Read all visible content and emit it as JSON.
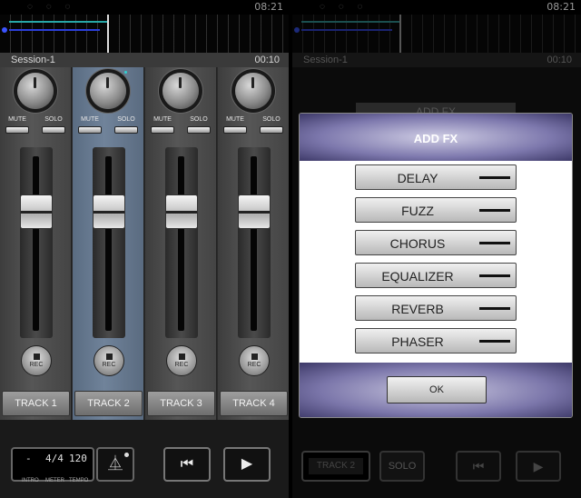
{
  "status": {
    "time": "08:21"
  },
  "session": {
    "name": "Session-1",
    "time": "00:10"
  },
  "mixer": {
    "mute_label": "MUTE",
    "solo_label": "SOLO",
    "rec_label": "REC",
    "tracks": [
      {
        "label": "TRACK 1",
        "selected": false
      },
      {
        "label": "TRACK 2",
        "selected": true
      },
      {
        "label": "TRACK 3",
        "selected": false
      },
      {
        "label": "TRACK 4",
        "selected": false
      }
    ]
  },
  "transport": {
    "intro_value": "-",
    "meter_value": "4/4",
    "tempo_value": "120",
    "intro_label": "INTRO",
    "meter_label": "METER",
    "tempo_label": "TEMPO"
  },
  "background_panel": {
    "add_fx_button": "ADD FX",
    "track_label": "TRACK 2",
    "solo_label": "SOLO"
  },
  "dialog": {
    "title": "ADD FX",
    "effects": [
      "DELAY",
      "FUZZ",
      "CHORUS",
      "EQUALIZER",
      "REVERB",
      "PHASER"
    ],
    "ok_label": "OK"
  },
  "icons": {
    "prev": "skip-back-icon",
    "play": "play-icon",
    "metronome": "metronome-icon"
  },
  "colors": {
    "selected_strip": "#70839a",
    "dialog_header": "#7d78ad",
    "timeline_track1": "#27a7a7",
    "timeline_track2": "#2b3fd9"
  }
}
